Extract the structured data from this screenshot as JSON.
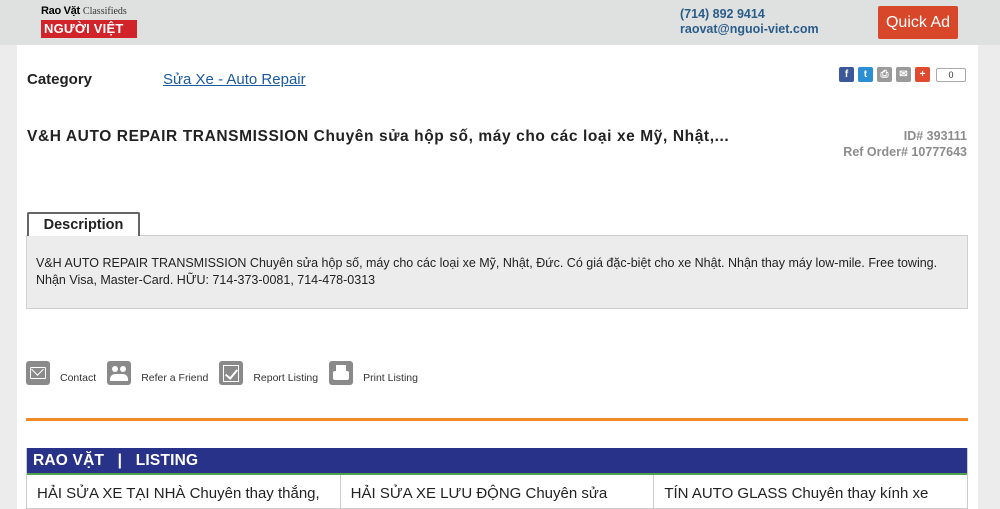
{
  "header": {
    "logo_top_bold": "Rao Vặt",
    "logo_top_script": "Classifieds",
    "logo_bottom": "NGƯỜI VIỆT",
    "phone": "(714) 892 9414",
    "email": "raovat@nguoi-viet.com",
    "quick_ad_label": "Quick Ad"
  },
  "listing_detail": {
    "category_label": "Category",
    "category_value": "Sửa Xe - Auto Repair",
    "share_count": "0",
    "title": "V&H AUTO REPAIR TRANSMISSION Chuyên sửa hộp số, máy cho các loại xe Mỹ, Nhật,...",
    "id_text": "ID# 393111",
    "ref_order_text": "Ref Order# 10777643",
    "description_tab": "Description",
    "description": "V&H AUTO REPAIR TRANSMISSION Chuyên sửa hộp số, máy cho các loại xe Mỹ, Nhật, Đức. Có giá đặc-biệt cho xe Nhật. Nhận thay máy low-mile. Free towing. Nhận Visa, Master-Card. HỮU: 714-373-0081, 714-478-0313"
  },
  "actions": [
    {
      "label": "Contact",
      "icon": "mail-icon"
    },
    {
      "label": "Refer a Friend",
      "icon": "friends-icon"
    },
    {
      "label": "Report Listing",
      "icon": "report-icon"
    },
    {
      "label": "Print Listing",
      "icon": "print-icon"
    }
  ],
  "share_icons": [
    "facebook-icon",
    "twitter-icon",
    "print-icon",
    "email-icon",
    "plus-icon"
  ],
  "related": {
    "heading": "RAO VẶT   |   LISTING",
    "items": [
      "HẢI SỬA XE TẠI NHÀ Chuyên thay thắng,",
      "HẢI SỬA XE LƯU ĐỘNG Chuyên sửa",
      "TÍN AUTO GLASS Chuyên thay kính xe"
    ]
  },
  "colors": {
    "accent_orange": "#f08a24",
    "listing_header_blue": "#283288",
    "quick_ad_red": "#d9472b",
    "link_blue": "#1a5aa0"
  }
}
